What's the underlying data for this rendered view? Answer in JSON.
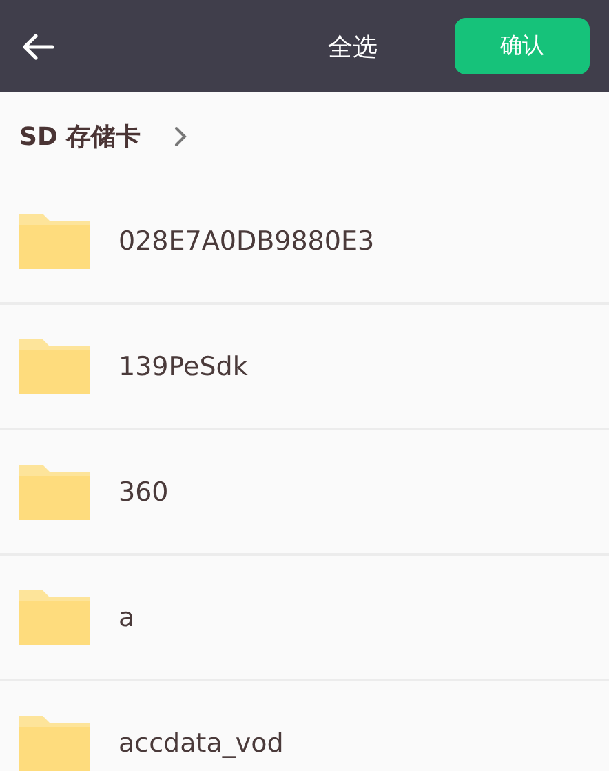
{
  "header": {
    "select_all": "全选",
    "confirm": "确认"
  },
  "breadcrumb": {
    "label": "SD 存储卡"
  },
  "folders": [
    {
      "name": "028E7A0DB9880E3"
    },
    {
      "name": "139PeSdk"
    },
    {
      "name": "360"
    },
    {
      "name": "a"
    },
    {
      "name": "accdata_vod"
    }
  ]
}
